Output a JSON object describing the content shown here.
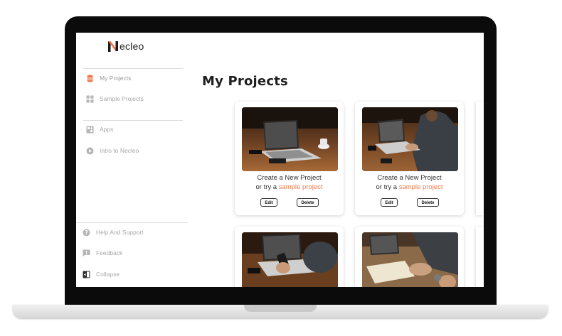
{
  "app": {
    "logo_text": "ecleo",
    "logo_letter": "N"
  },
  "sidebar": {
    "items": [
      {
        "label": "My Projects",
        "icon": "database-icon",
        "active": true
      },
      {
        "label": "Sample Projects",
        "icon": "grid-icon",
        "active": false
      },
      {
        "label": "Apps",
        "icon": "apps-icon",
        "active": false
      },
      {
        "label": "Intro to Necleo",
        "icon": "play-circle-icon",
        "active": false
      }
    ],
    "bottom_items": [
      {
        "label": "Help And Support",
        "icon": "help-icon"
      },
      {
        "label": "Feedback",
        "icon": "feedback-icon"
      },
      {
        "label": "Collapse",
        "icon": "collapse-icon"
      }
    ]
  },
  "main": {
    "title": "My Projects",
    "cards": [
      {
        "line1": "Create a New Project",
        "line2_prefix": "or try a ",
        "line2_link": "sample project",
        "edit": "Edit",
        "delete": "Delete"
      },
      {
        "line1": "Create a New Project",
        "line2_prefix": "or try a ",
        "line2_link": "sample project",
        "edit": "Edit",
        "delete": "Delete"
      },
      {},
      {}
    ]
  },
  "colors": {
    "accent": "#f07a4c",
    "active_icon": "#f07a4c",
    "inactive_icon": "#b5b5b5"
  }
}
